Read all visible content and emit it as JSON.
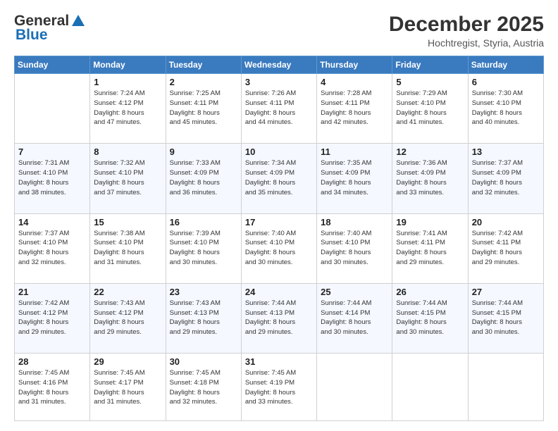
{
  "header": {
    "logo_general": "General",
    "logo_blue": "Blue",
    "month_title": "December 2025",
    "location": "Hochtregist, Styria, Austria"
  },
  "weekdays": [
    "Sunday",
    "Monday",
    "Tuesday",
    "Wednesday",
    "Thursday",
    "Friday",
    "Saturday"
  ],
  "weeks": [
    [
      {
        "day": "",
        "info": ""
      },
      {
        "day": "1",
        "info": "Sunrise: 7:24 AM\nSunset: 4:12 PM\nDaylight: 8 hours\nand 47 minutes."
      },
      {
        "day": "2",
        "info": "Sunrise: 7:25 AM\nSunset: 4:11 PM\nDaylight: 8 hours\nand 45 minutes."
      },
      {
        "day": "3",
        "info": "Sunrise: 7:26 AM\nSunset: 4:11 PM\nDaylight: 8 hours\nand 44 minutes."
      },
      {
        "day": "4",
        "info": "Sunrise: 7:28 AM\nSunset: 4:11 PM\nDaylight: 8 hours\nand 42 minutes."
      },
      {
        "day": "5",
        "info": "Sunrise: 7:29 AM\nSunset: 4:10 PM\nDaylight: 8 hours\nand 41 minutes."
      },
      {
        "day": "6",
        "info": "Sunrise: 7:30 AM\nSunset: 4:10 PM\nDaylight: 8 hours\nand 40 minutes."
      }
    ],
    [
      {
        "day": "7",
        "info": "Sunrise: 7:31 AM\nSunset: 4:10 PM\nDaylight: 8 hours\nand 38 minutes."
      },
      {
        "day": "8",
        "info": "Sunrise: 7:32 AM\nSunset: 4:10 PM\nDaylight: 8 hours\nand 37 minutes."
      },
      {
        "day": "9",
        "info": "Sunrise: 7:33 AM\nSunset: 4:09 PM\nDaylight: 8 hours\nand 36 minutes."
      },
      {
        "day": "10",
        "info": "Sunrise: 7:34 AM\nSunset: 4:09 PM\nDaylight: 8 hours\nand 35 minutes."
      },
      {
        "day": "11",
        "info": "Sunrise: 7:35 AM\nSunset: 4:09 PM\nDaylight: 8 hours\nand 34 minutes."
      },
      {
        "day": "12",
        "info": "Sunrise: 7:36 AM\nSunset: 4:09 PM\nDaylight: 8 hours\nand 33 minutes."
      },
      {
        "day": "13",
        "info": "Sunrise: 7:37 AM\nSunset: 4:09 PM\nDaylight: 8 hours\nand 32 minutes."
      }
    ],
    [
      {
        "day": "14",
        "info": "Sunrise: 7:37 AM\nSunset: 4:10 PM\nDaylight: 8 hours\nand 32 minutes."
      },
      {
        "day": "15",
        "info": "Sunrise: 7:38 AM\nSunset: 4:10 PM\nDaylight: 8 hours\nand 31 minutes."
      },
      {
        "day": "16",
        "info": "Sunrise: 7:39 AM\nSunset: 4:10 PM\nDaylight: 8 hours\nand 30 minutes."
      },
      {
        "day": "17",
        "info": "Sunrise: 7:40 AM\nSunset: 4:10 PM\nDaylight: 8 hours\nand 30 minutes."
      },
      {
        "day": "18",
        "info": "Sunrise: 7:40 AM\nSunset: 4:10 PM\nDaylight: 8 hours\nand 30 minutes."
      },
      {
        "day": "19",
        "info": "Sunrise: 7:41 AM\nSunset: 4:11 PM\nDaylight: 8 hours\nand 29 minutes."
      },
      {
        "day": "20",
        "info": "Sunrise: 7:42 AM\nSunset: 4:11 PM\nDaylight: 8 hours\nand 29 minutes."
      }
    ],
    [
      {
        "day": "21",
        "info": "Sunrise: 7:42 AM\nSunset: 4:12 PM\nDaylight: 8 hours\nand 29 minutes."
      },
      {
        "day": "22",
        "info": "Sunrise: 7:43 AM\nSunset: 4:12 PM\nDaylight: 8 hours\nand 29 minutes."
      },
      {
        "day": "23",
        "info": "Sunrise: 7:43 AM\nSunset: 4:13 PM\nDaylight: 8 hours\nand 29 minutes."
      },
      {
        "day": "24",
        "info": "Sunrise: 7:44 AM\nSunset: 4:13 PM\nDaylight: 8 hours\nand 29 minutes."
      },
      {
        "day": "25",
        "info": "Sunrise: 7:44 AM\nSunset: 4:14 PM\nDaylight: 8 hours\nand 30 minutes."
      },
      {
        "day": "26",
        "info": "Sunrise: 7:44 AM\nSunset: 4:15 PM\nDaylight: 8 hours\nand 30 minutes."
      },
      {
        "day": "27",
        "info": "Sunrise: 7:44 AM\nSunset: 4:15 PM\nDaylight: 8 hours\nand 30 minutes."
      }
    ],
    [
      {
        "day": "28",
        "info": "Sunrise: 7:45 AM\nSunset: 4:16 PM\nDaylight: 8 hours\nand 31 minutes."
      },
      {
        "day": "29",
        "info": "Sunrise: 7:45 AM\nSunset: 4:17 PM\nDaylight: 8 hours\nand 31 minutes."
      },
      {
        "day": "30",
        "info": "Sunrise: 7:45 AM\nSunset: 4:18 PM\nDaylight: 8 hours\nand 32 minutes."
      },
      {
        "day": "31",
        "info": "Sunrise: 7:45 AM\nSunset: 4:19 PM\nDaylight: 8 hours\nand 33 minutes."
      },
      {
        "day": "",
        "info": ""
      },
      {
        "day": "",
        "info": ""
      },
      {
        "day": "",
        "info": ""
      }
    ]
  ]
}
